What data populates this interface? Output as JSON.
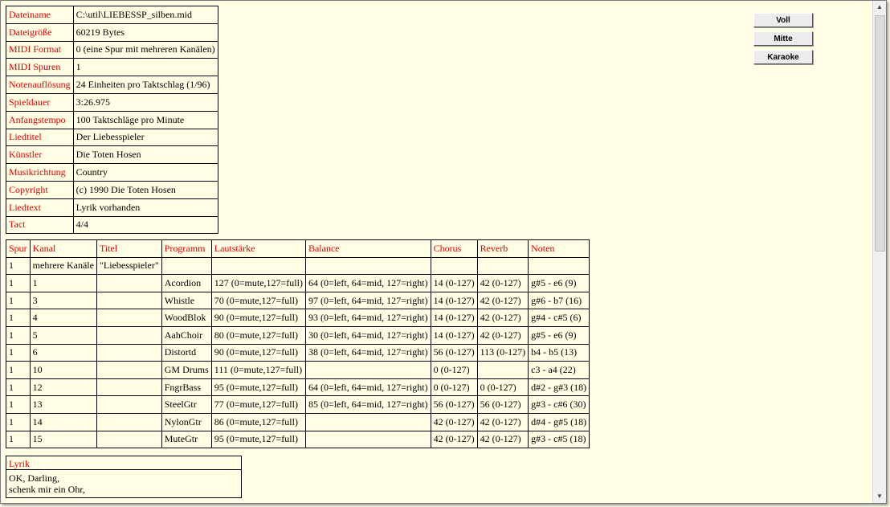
{
  "buttons": {
    "voll": "Voll",
    "mitte": "Mitte",
    "karaoke": "Karaoke"
  },
  "info": [
    {
      "key": "Dateiname",
      "value": "C:\\util\\LIEBESSP_silben.mid"
    },
    {
      "key": "Dateigröße",
      "value": "60219 Bytes"
    },
    {
      "key": "MIDI Format",
      "value": "0 (eine Spur mit mehreren Kanälen)"
    },
    {
      "key": "MIDI Spuren",
      "value": "1"
    },
    {
      "key": "Notenauflösung",
      "value": "24 Einheiten pro Taktschlag (1/96)"
    },
    {
      "key": "Spieldauer",
      "value": "3:26.975"
    },
    {
      "key": "Anfangstempo",
      "value": "100 Taktschläge pro Minute"
    },
    {
      "key": "Liedtitel",
      "value": "Der Liebesspieler"
    },
    {
      "key": "Künstler",
      "value": "Die Toten Hosen"
    },
    {
      "key": "Musikrichtung",
      "value": "Country"
    },
    {
      "key": "Copyright",
      "value": "(c) 1990 Die Toten Hosen"
    },
    {
      "key": "Liedtext",
      "value": "Lyrik vorhanden"
    },
    {
      "key": "Tact",
      "value": "4/4"
    }
  ],
  "tracks": {
    "headers": [
      "Spur",
      "Kanal",
      "Titel",
      "Programm",
      "Lautstärke",
      "Balance",
      "Chorus",
      "Reverb",
      "Noten"
    ],
    "rows": [
      [
        "1",
        "mehrere Kanäle",
        "\"Liebesspieler\"",
        "",
        "",
        "",
        "",
        "",
        ""
      ],
      [
        "1",
        "1",
        "",
        "Acordion",
        "127  (0=mute,127=full)",
        "64 (0=left, 64=mid, 127=right)",
        "14 (0-127)",
        "42 (0-127)",
        "g#5 - e6 (9)"
      ],
      [
        "1",
        "3",
        "",
        "Whistle",
        "70  (0=mute,127=full)",
        "97 (0=left, 64=mid, 127=right)",
        "14 (0-127)",
        "42 (0-127)",
        "g#6 - b7 (16)"
      ],
      [
        "1",
        "4",
        "",
        "WoodBlok",
        "90  (0=mute,127=full)",
        "93 (0=left, 64=mid, 127=right)",
        "14 (0-127)",
        "42 (0-127)",
        "g#4 - c#5 (6)"
      ],
      [
        "1",
        "5",
        "",
        "AahChoir",
        "80  (0=mute,127=full)",
        "30 (0=left, 64=mid, 127=right)",
        "14 (0-127)",
        "42 (0-127)",
        "g#5 - e6 (9)"
      ],
      [
        "1",
        "6",
        "",
        "Distortd",
        "90  (0=mute,127=full)",
        "38 (0=left, 64=mid, 127=right)",
        "56 (0-127)",
        "113 (0-127)",
        "b4 - b5 (13)"
      ],
      [
        "1",
        "10",
        "",
        "GM Drums",
        "111  (0=mute,127=full)",
        "",
        "0 (0-127)",
        "",
        "c3 - a4 (22)"
      ],
      [
        "1",
        "12",
        "",
        "FngrBass",
        "95  (0=mute,127=full)",
        "64 (0=left, 64=mid, 127=right)",
        "0 (0-127)",
        "0 (0-127)",
        "d#2 - g#3 (18)"
      ],
      [
        "1",
        "13",
        "",
        "SteelGtr",
        "77  (0=mute,127=full)",
        "85 (0=left, 64=mid, 127=right)",
        "56 (0-127)",
        "56 (0-127)",
        "g#3 - c#6 (30)"
      ],
      [
        "1",
        "14",
        "",
        "NylonGtr",
        "86  (0=mute,127=full)",
        "",
        "42 (0-127)",
        "42 (0-127)",
        "d#4 - g#5 (18)"
      ],
      [
        "1",
        "15",
        "",
        "MuteGtr",
        "95  (0=mute,127=full)",
        "",
        "42 (0-127)",
        "42 (0-127)",
        "g#3 - c#5 (18)"
      ]
    ]
  },
  "lyric": {
    "title": "Lyrik",
    "lines": [
      "OK, Darling,",
      "schenk mir ein Ohr,"
    ]
  },
  "scrollbar": {
    "up": "▲",
    "down": "▼"
  }
}
